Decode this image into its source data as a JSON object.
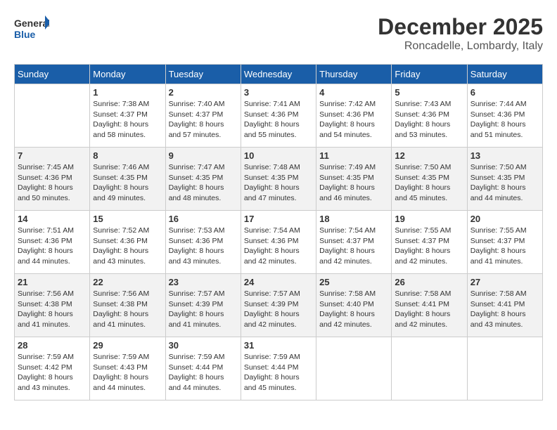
{
  "logo": {
    "general": "General",
    "blue": "Blue"
  },
  "title": {
    "month_year": "December 2025",
    "location": "Roncadelle, Lombardy, Italy"
  },
  "weekdays": [
    "Sunday",
    "Monday",
    "Tuesday",
    "Wednesday",
    "Thursday",
    "Friday",
    "Saturday"
  ],
  "weeks": [
    [
      {
        "day": "",
        "info": ""
      },
      {
        "day": "1",
        "info": "Sunrise: 7:38 AM\nSunset: 4:37 PM\nDaylight: 8 hours\nand 58 minutes."
      },
      {
        "day": "2",
        "info": "Sunrise: 7:40 AM\nSunset: 4:37 PM\nDaylight: 8 hours\nand 57 minutes."
      },
      {
        "day": "3",
        "info": "Sunrise: 7:41 AM\nSunset: 4:36 PM\nDaylight: 8 hours\nand 55 minutes."
      },
      {
        "day": "4",
        "info": "Sunrise: 7:42 AM\nSunset: 4:36 PM\nDaylight: 8 hours\nand 54 minutes."
      },
      {
        "day": "5",
        "info": "Sunrise: 7:43 AM\nSunset: 4:36 PM\nDaylight: 8 hours\nand 53 minutes."
      },
      {
        "day": "6",
        "info": "Sunrise: 7:44 AM\nSunset: 4:36 PM\nDaylight: 8 hours\nand 51 minutes."
      }
    ],
    [
      {
        "day": "7",
        "info": "Sunrise: 7:45 AM\nSunset: 4:36 PM\nDaylight: 8 hours\nand 50 minutes."
      },
      {
        "day": "8",
        "info": "Sunrise: 7:46 AM\nSunset: 4:35 PM\nDaylight: 8 hours\nand 49 minutes."
      },
      {
        "day": "9",
        "info": "Sunrise: 7:47 AM\nSunset: 4:35 PM\nDaylight: 8 hours\nand 48 minutes."
      },
      {
        "day": "10",
        "info": "Sunrise: 7:48 AM\nSunset: 4:35 PM\nDaylight: 8 hours\nand 47 minutes."
      },
      {
        "day": "11",
        "info": "Sunrise: 7:49 AM\nSunset: 4:35 PM\nDaylight: 8 hours\nand 46 minutes."
      },
      {
        "day": "12",
        "info": "Sunrise: 7:50 AM\nSunset: 4:35 PM\nDaylight: 8 hours\nand 45 minutes."
      },
      {
        "day": "13",
        "info": "Sunrise: 7:50 AM\nSunset: 4:35 PM\nDaylight: 8 hours\nand 44 minutes."
      }
    ],
    [
      {
        "day": "14",
        "info": "Sunrise: 7:51 AM\nSunset: 4:36 PM\nDaylight: 8 hours\nand 44 minutes."
      },
      {
        "day": "15",
        "info": "Sunrise: 7:52 AM\nSunset: 4:36 PM\nDaylight: 8 hours\nand 43 minutes."
      },
      {
        "day": "16",
        "info": "Sunrise: 7:53 AM\nSunset: 4:36 PM\nDaylight: 8 hours\nand 43 minutes."
      },
      {
        "day": "17",
        "info": "Sunrise: 7:54 AM\nSunset: 4:36 PM\nDaylight: 8 hours\nand 42 minutes."
      },
      {
        "day": "18",
        "info": "Sunrise: 7:54 AM\nSunset: 4:37 PM\nDaylight: 8 hours\nand 42 minutes."
      },
      {
        "day": "19",
        "info": "Sunrise: 7:55 AM\nSunset: 4:37 PM\nDaylight: 8 hours\nand 42 minutes."
      },
      {
        "day": "20",
        "info": "Sunrise: 7:55 AM\nSunset: 4:37 PM\nDaylight: 8 hours\nand 41 minutes."
      }
    ],
    [
      {
        "day": "21",
        "info": "Sunrise: 7:56 AM\nSunset: 4:38 PM\nDaylight: 8 hours\nand 41 minutes."
      },
      {
        "day": "22",
        "info": "Sunrise: 7:56 AM\nSunset: 4:38 PM\nDaylight: 8 hours\nand 41 minutes."
      },
      {
        "day": "23",
        "info": "Sunrise: 7:57 AM\nSunset: 4:39 PM\nDaylight: 8 hours\nand 41 minutes."
      },
      {
        "day": "24",
        "info": "Sunrise: 7:57 AM\nSunset: 4:39 PM\nDaylight: 8 hours\nand 42 minutes."
      },
      {
        "day": "25",
        "info": "Sunrise: 7:58 AM\nSunset: 4:40 PM\nDaylight: 8 hours\nand 42 minutes."
      },
      {
        "day": "26",
        "info": "Sunrise: 7:58 AM\nSunset: 4:41 PM\nDaylight: 8 hours\nand 42 minutes."
      },
      {
        "day": "27",
        "info": "Sunrise: 7:58 AM\nSunset: 4:41 PM\nDaylight: 8 hours\nand 43 minutes."
      }
    ],
    [
      {
        "day": "28",
        "info": "Sunrise: 7:59 AM\nSunset: 4:42 PM\nDaylight: 8 hours\nand 43 minutes."
      },
      {
        "day": "29",
        "info": "Sunrise: 7:59 AM\nSunset: 4:43 PM\nDaylight: 8 hours\nand 44 minutes."
      },
      {
        "day": "30",
        "info": "Sunrise: 7:59 AM\nSunset: 4:44 PM\nDaylight: 8 hours\nand 44 minutes."
      },
      {
        "day": "31",
        "info": "Sunrise: 7:59 AM\nSunset: 4:44 PM\nDaylight: 8 hours\nand 45 minutes."
      },
      {
        "day": "",
        "info": ""
      },
      {
        "day": "",
        "info": ""
      },
      {
        "day": "",
        "info": ""
      }
    ]
  ]
}
